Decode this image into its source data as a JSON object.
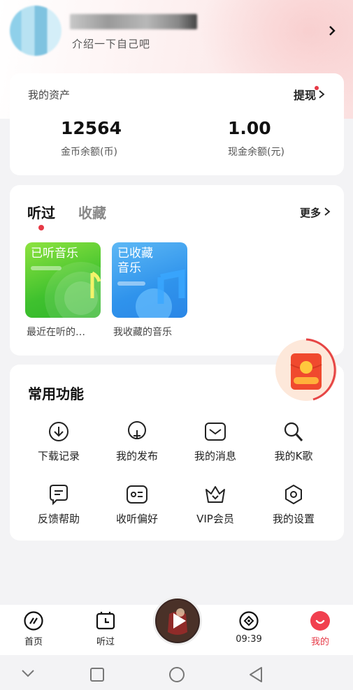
{
  "profile": {
    "intro": "介绍一下自己吧"
  },
  "assets": {
    "title": "我的资产",
    "withdraw_label": "提现",
    "coins_value": "12564",
    "coins_label": "金币余额(币)",
    "cash_value": "1.00",
    "cash_label": "现金余额(元)"
  },
  "listen": {
    "tab_listened": "听过",
    "tab_favorites": "收藏",
    "more_label": "更多",
    "tiles": [
      {
        "title": "已听音乐",
        "caption": "最近在听的…"
      },
      {
        "title_line1": "已收藏",
        "title_line2": "音乐",
        "caption": "我收藏的音乐"
      }
    ]
  },
  "functions": {
    "title": "常用功能",
    "items": [
      {
        "label": "下载记录",
        "icon": "download-icon"
      },
      {
        "label": "我的发布",
        "icon": "publish-icon"
      },
      {
        "label": "我的消息",
        "icon": "message-icon"
      },
      {
        "label": "我的K歌",
        "icon": "karaoke-icon"
      },
      {
        "label": "反馈帮助",
        "icon": "feedback-icon"
      },
      {
        "label": "收听偏好",
        "icon": "preference-icon"
      },
      {
        "label": "VIP会员",
        "icon": "crown-icon"
      },
      {
        "label": "我的设置",
        "icon": "settings-icon"
      }
    ]
  },
  "bottom_nav": {
    "items": [
      {
        "label": "首页",
        "icon": "home-icon"
      },
      {
        "label": "听过",
        "icon": "history-icon"
      },
      {
        "label": "09:39",
        "icon": "explore-icon"
      },
      {
        "label": "我的",
        "icon": "profile-icon"
      }
    ],
    "active_color": "#e63946"
  },
  "colors": {
    "accent": "#e63946",
    "green_tile": "#3fc12e",
    "blue_tile": "#2f93ec"
  }
}
